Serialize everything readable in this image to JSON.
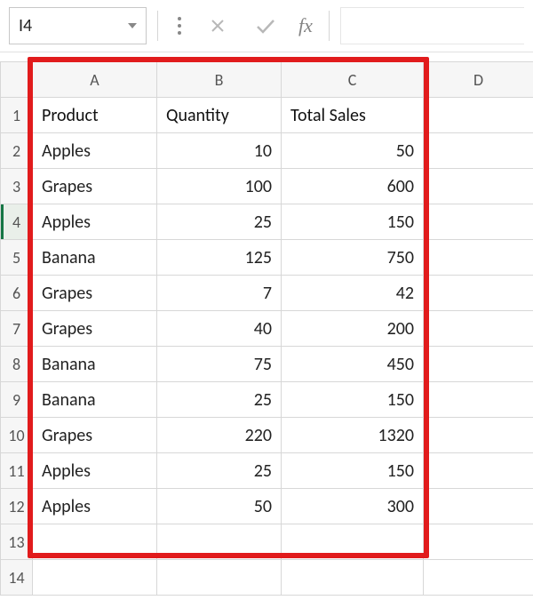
{
  "formula_bar": {
    "namebox_value": "I4",
    "fx_label": "fx"
  },
  "column_headers": [
    "A",
    "B",
    "C",
    "D"
  ],
  "row_headers": [
    "1",
    "2",
    "3",
    "4",
    "5",
    "6",
    "7",
    "8",
    "9",
    "10",
    "11",
    "12",
    "13",
    "14"
  ],
  "active_row": 4,
  "table": {
    "headers": {
      "product": "Product",
      "quantity": "Quantity",
      "total": "Total Sales"
    },
    "rows": [
      {
        "product": "Apples",
        "quantity": 10,
        "total": 50
      },
      {
        "product": "Grapes",
        "quantity": 100,
        "total": 600
      },
      {
        "product": "Apples",
        "quantity": 25,
        "total": 150
      },
      {
        "product": "Banana",
        "quantity": 125,
        "total": 750
      },
      {
        "product": "Grapes",
        "quantity": 7,
        "total": 42
      },
      {
        "product": "Grapes",
        "quantity": 40,
        "total": 200
      },
      {
        "product": "Banana",
        "quantity": 75,
        "total": 450
      },
      {
        "product": "Banana",
        "quantity": 25,
        "total": 150
      },
      {
        "product": "Grapes",
        "quantity": 220,
        "total": 1320
      },
      {
        "product": "Apples",
        "quantity": 25,
        "total": 150
      },
      {
        "product": "Apples",
        "quantity": 50,
        "total": 300
      }
    ]
  },
  "chart_data": {
    "type": "table",
    "title": "",
    "columns": [
      "Product",
      "Quantity",
      "Total Sales"
    ],
    "rows": [
      [
        "Apples",
        10,
        50
      ],
      [
        "Grapes",
        100,
        600
      ],
      [
        "Apples",
        25,
        150
      ],
      [
        "Banana",
        125,
        750
      ],
      [
        "Grapes",
        7,
        42
      ],
      [
        "Grapes",
        40,
        200
      ],
      [
        "Banana",
        75,
        450
      ],
      [
        "Banana",
        25,
        150
      ],
      [
        "Grapes",
        220,
        1320
      ],
      [
        "Apples",
        25,
        150
      ],
      [
        "Apples",
        50,
        300
      ]
    ]
  },
  "highlight": {
    "color": "#e11b1c"
  }
}
